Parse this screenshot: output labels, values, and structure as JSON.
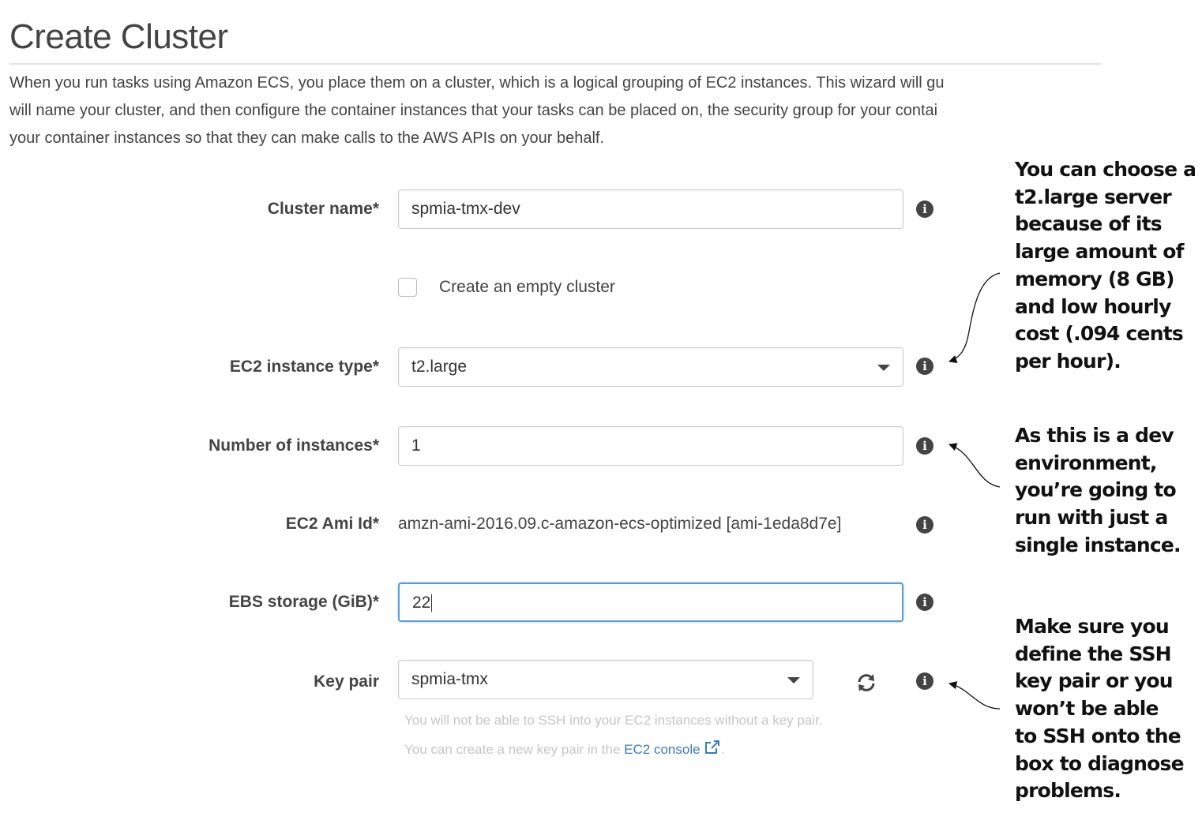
{
  "page": {
    "title": "Create Cluster",
    "description_lines": [
      "When you run tasks using Amazon ECS, you place them on a cluster, which is a logical grouping of EC2 instances. This wizard will gu",
      "will name your cluster, and then configure the container instances that your tasks can be placed on, the security group for your contai",
      "your container instances so that they can make calls to the AWS APIs on your behalf."
    ]
  },
  "form": {
    "cluster_name": {
      "label": "Cluster name*",
      "value": "spmia-tmx-dev"
    },
    "empty_cluster": {
      "label": "Create an empty cluster",
      "checked": false
    },
    "instance_type": {
      "label": "EC2 instance type*",
      "value": "t2.large"
    },
    "num_instances": {
      "label": "Number of instances*",
      "value": "1"
    },
    "ami_id": {
      "label": "EC2 Ami Id*",
      "value": "amzn-ami-2016.09.c-amazon-ecs-optimized [ami-1eda8d7e]"
    },
    "ebs_storage": {
      "label": "EBS storage (GiB)*",
      "value": "22"
    },
    "key_pair": {
      "label": "Key pair",
      "value": "spmia-tmx",
      "help_line1": "You will not be able to SSH into your EC2 instances without a key pair.",
      "help_line2_prefix": "You can create a new key pair in the ",
      "help_link": "EC2 console",
      "help_line2_suffix": "."
    },
    "info_glyph": "i"
  },
  "annotations": {
    "instance_type": [
      "You can choose a",
      "t2.large server",
      "because of its",
      "large amount of",
      "memory (8 GB)",
      "and low hourly",
      "cost (.094 cents",
      "per hour)."
    ],
    "num_instances": [
      "As this is a dev",
      "environment,",
      "you’re going to",
      "run with just a",
      "single instance."
    ],
    "key_pair": [
      "Make sure you",
      "define the SSH",
      "key pair or you",
      "won’t be able",
      "to SSH onto the",
      "box to diagnose",
      "problems."
    ]
  },
  "colors": {
    "link": "#3a7bbf",
    "focus_border": "#5b9bd5",
    "info_icon": "#444444"
  }
}
